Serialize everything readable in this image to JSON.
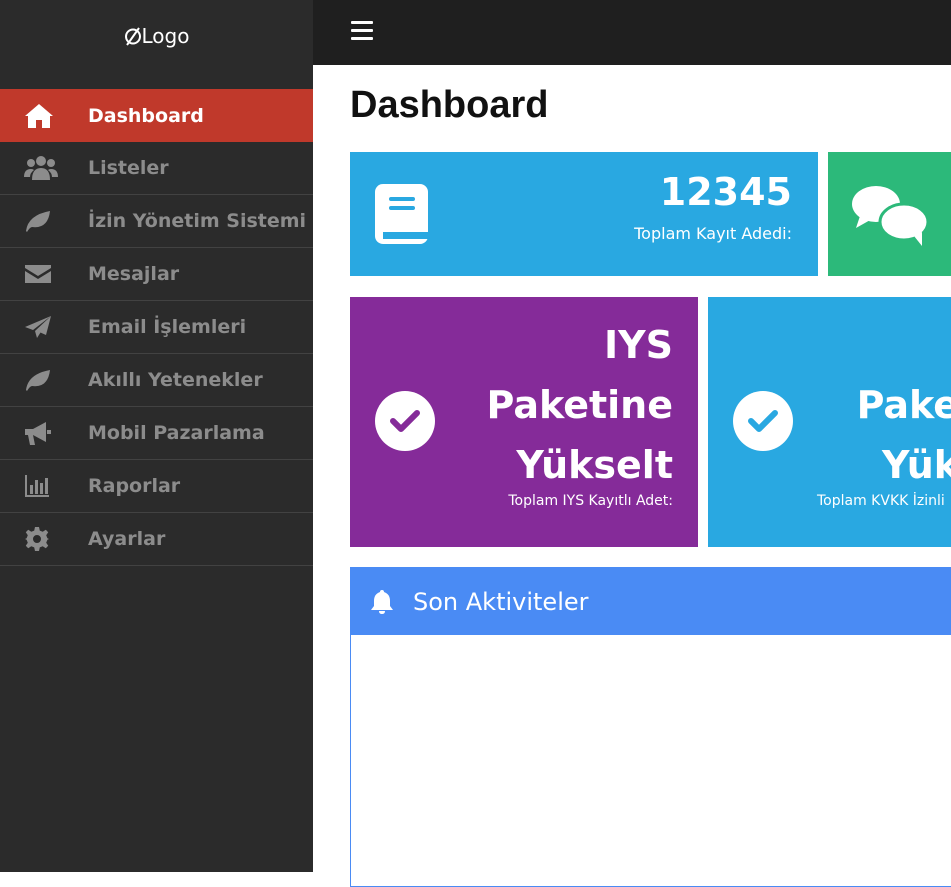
{
  "brand": {
    "logo_text": "Logo"
  },
  "sidebar": {
    "items": [
      {
        "label": "Dashboard",
        "icon": "home-icon"
      },
      {
        "label": "Listeler",
        "icon": "users-icon"
      },
      {
        "label": "İzin Yönetim Sistemi",
        "icon": "leaf-icon"
      },
      {
        "label": "Mesajlar",
        "icon": "envelope-icon"
      },
      {
        "label": "Email İşlemleri",
        "icon": "paper-plane-icon"
      },
      {
        "label": "Akıllı Yetenekler",
        "icon": "leaf-icon"
      },
      {
        "label": "Mobil Pazarlama",
        "icon": "bullhorn-icon"
      },
      {
        "label": "Raporlar",
        "icon": "bar-chart-icon"
      },
      {
        "label": "Ayarlar",
        "icon": "gear-icon"
      }
    ],
    "active_index": 0
  },
  "main": {
    "title": "Dashboard",
    "cards": {
      "total_records": {
        "value": "12345",
        "label": "Toplam Kayıt Adedi:"
      },
      "iys": {
        "line1": "IYS",
        "line2": "Paketine",
        "line3": "Yükselt",
        "label": "Toplam IYS Kayıtlı Adet:"
      },
      "kvkk": {
        "line1": "Pake",
        "line2": "Yük",
        "label": "Toplam KVKK İzinli"
      }
    },
    "activity": {
      "title": "Son Aktiviteler"
    }
  },
  "colors": {
    "sidebar_bg": "#2b2b2b",
    "active_item": "#c0392b",
    "topbar_bg": "#1f1f1f",
    "blue_card": "#29a8e1",
    "green_card": "#2cb97a",
    "purple_card": "#852b99",
    "activity_header": "#4a8bf4"
  }
}
